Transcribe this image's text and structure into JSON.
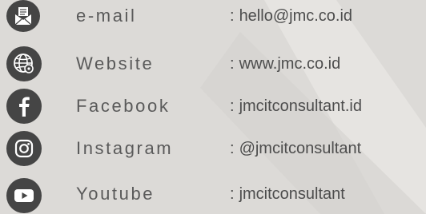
{
  "contacts": [
    {
      "icon": "envelope-icon",
      "label": "e-mail",
      "separator": ":",
      "value": "hello@jmc.co.id"
    },
    {
      "icon": "globe-icon",
      "label": "Website",
      "separator": ":",
      "value": "www.jmc.co.id"
    },
    {
      "icon": "facebook-icon",
      "label": "Facebook",
      "separator": ":",
      "value": "jmcitconsultant.id"
    },
    {
      "icon": "instagram-icon",
      "label": "Instagram",
      "separator": ":",
      "value": "@jmcitconsultant"
    },
    {
      "icon": "youtube-icon",
      "label": "Youtube",
      "separator": ":",
      "value": "jmcitconsultant"
    }
  ],
  "colors": {
    "background": "#dcdad7",
    "icon_circle": "#454545",
    "text": "#5a5a5a"
  }
}
